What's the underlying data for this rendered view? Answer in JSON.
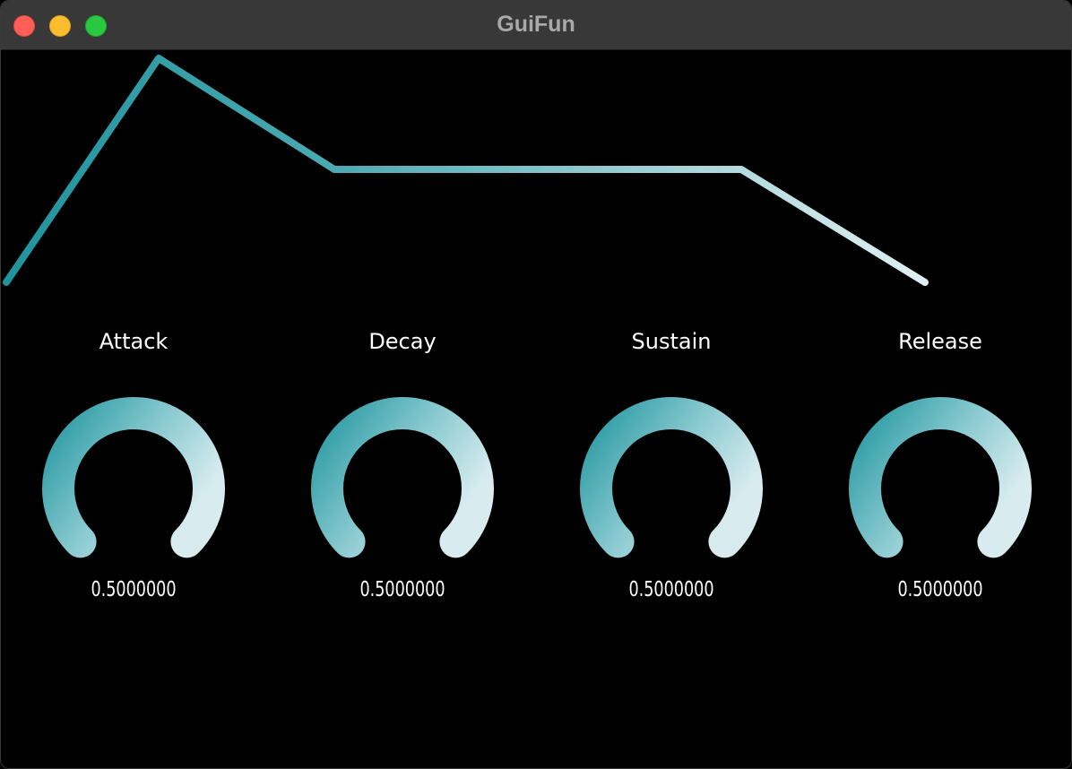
{
  "window": {
    "title": "GuiFun",
    "buttons": [
      "close",
      "minimize",
      "maximize"
    ]
  },
  "colors": {
    "background": "#000000",
    "titlebar": "#383838",
    "accent_dark": "#2a9aa3",
    "accent_light": "#d8ecef",
    "indicator": "#ffffff"
  },
  "envelope": {
    "attack": 0.5,
    "decay": 0.5,
    "sustain": 0.5,
    "release": 0.5
  },
  "knobs": [
    {
      "id": "attack",
      "label": "Attack",
      "value": 0.5,
      "value_text": "0.5000000"
    },
    {
      "id": "decay",
      "label": "Decay",
      "value": 0.5,
      "value_text": "0.5000000"
    },
    {
      "id": "sustain",
      "label": "Sustain",
      "value": 0.5,
      "value_text": "0.5000000"
    },
    {
      "id": "release",
      "label": "Release",
      "value": 0.5,
      "value_text": "0.5000000"
    }
  ]
}
